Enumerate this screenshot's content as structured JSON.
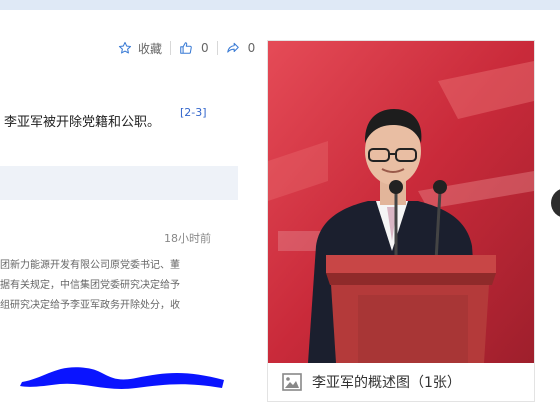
{
  "actions": {
    "favorite_label": "收藏",
    "like_count": "0",
    "share_count": "0"
  },
  "article": {
    "lead_text": "李亚军被开除党籍和公职。",
    "ref": "[2-3]"
  },
  "news": {
    "time": "18小时前",
    "lines": [
      "团新力能源开发有限公司原党委书记、董",
      "据有关规定，中信集团党委研究决定给予",
      "组研究决定给予李亚军政务开除处分，收"
    ]
  },
  "album": {
    "caption": "李亚军的概述图（1张）"
  },
  "colors": {
    "accent": "#2f6fd6",
    "scribble": "#0a14ff",
    "photo_bg": "#c92a3a",
    "podium": "#b43a3a"
  }
}
